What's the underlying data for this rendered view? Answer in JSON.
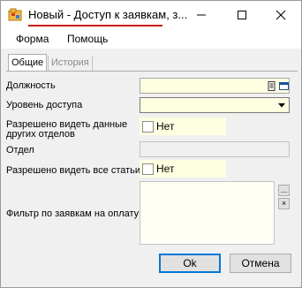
{
  "window": {
    "title": "Новый - Доступ к заявкам, з..."
  },
  "menu": {
    "items": [
      "Форма",
      "Помощь"
    ]
  },
  "tabs": {
    "general": "Общие",
    "history": "История"
  },
  "form": {
    "position_label": "Должность",
    "access_level_label": "Уровень доступа",
    "other_depts_label_1": "Разрешено видеть данные",
    "other_depts_label_2": "других отделов",
    "other_depts_value": "Нет",
    "department_label": "Отдел",
    "all_items_label": "Разрешено видеть все статьи",
    "all_items_value": "Нет",
    "filter_label": "Фильтр по заявкам на оплату",
    "filter_more_label": "...",
    "filter_clear_label": "×"
  },
  "buttons": {
    "ok": "Ok",
    "cancel": "Отмена"
  },
  "colors": {
    "field_bg": "#fefee0",
    "title_underline": "#cc1111",
    "ok_border": "#0078d7"
  }
}
